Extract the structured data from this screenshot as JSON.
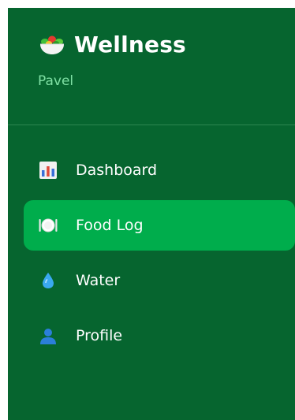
{
  "brand": {
    "icon": "salad-bowl-icon",
    "title": "Wellness"
  },
  "user": {
    "name": "Pavel"
  },
  "nav": {
    "items": [
      {
        "icon": "bar-chart-icon",
        "label": "Dashboard",
        "active": false
      },
      {
        "icon": "plate-cutlery-icon",
        "label": "Food Log",
        "active": true
      },
      {
        "icon": "water-drop-icon",
        "label": "Water",
        "active": false
      },
      {
        "icon": "user-icon",
        "label": "Profile",
        "active": false
      }
    ]
  },
  "colors": {
    "sidebar_bg": "#06652f",
    "active_bg": "#00ad4c",
    "user_name": "#7fe0a4",
    "text": "#ffffff"
  }
}
